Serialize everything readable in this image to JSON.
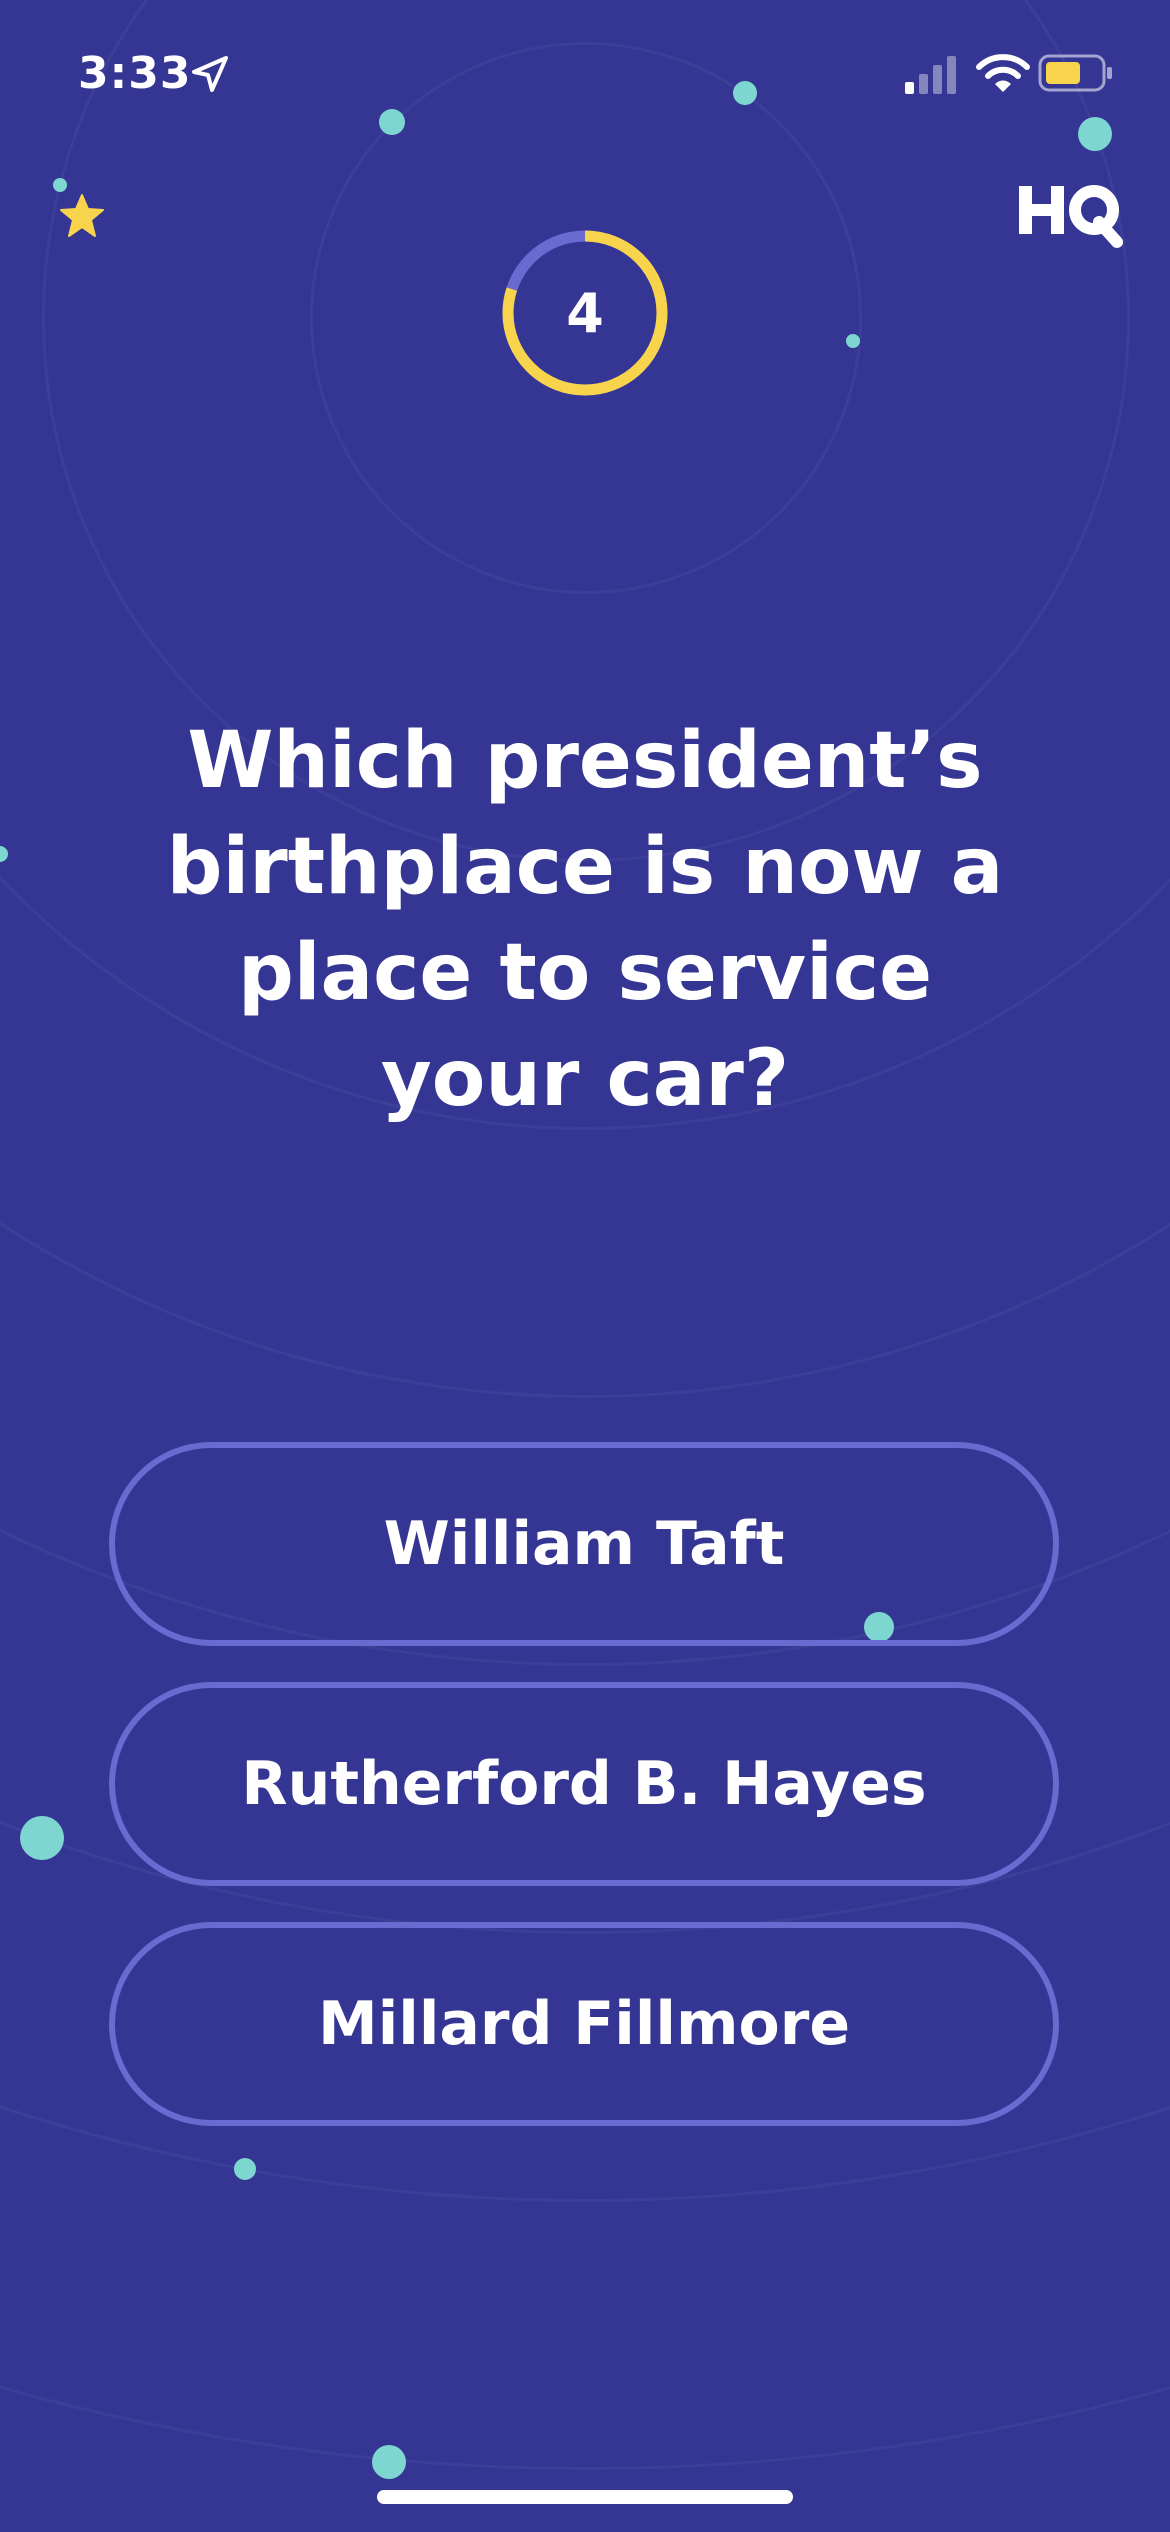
{
  "status_bar": {
    "time": "3:33"
  },
  "game": {
    "timer_value": "4",
    "timer_progress": 0.8,
    "question": "Which president’s birthplace is now a place to service your car?",
    "answers": [
      {
        "label": "William Taft"
      },
      {
        "label": "Rutherford B. Hayes"
      },
      {
        "label": "Millard Fillmore"
      }
    ]
  },
  "colors": {
    "background": "#353693",
    "accent_yellow": "#f8d44c",
    "answer_border": "#6a6ad0",
    "dot": "#7ed6d0"
  },
  "icons": {
    "star": "star-icon",
    "logo": "hq-logo",
    "location": "location-icon",
    "signal": "signal-icon",
    "wifi": "wifi-icon",
    "battery": "battery-icon"
  }
}
